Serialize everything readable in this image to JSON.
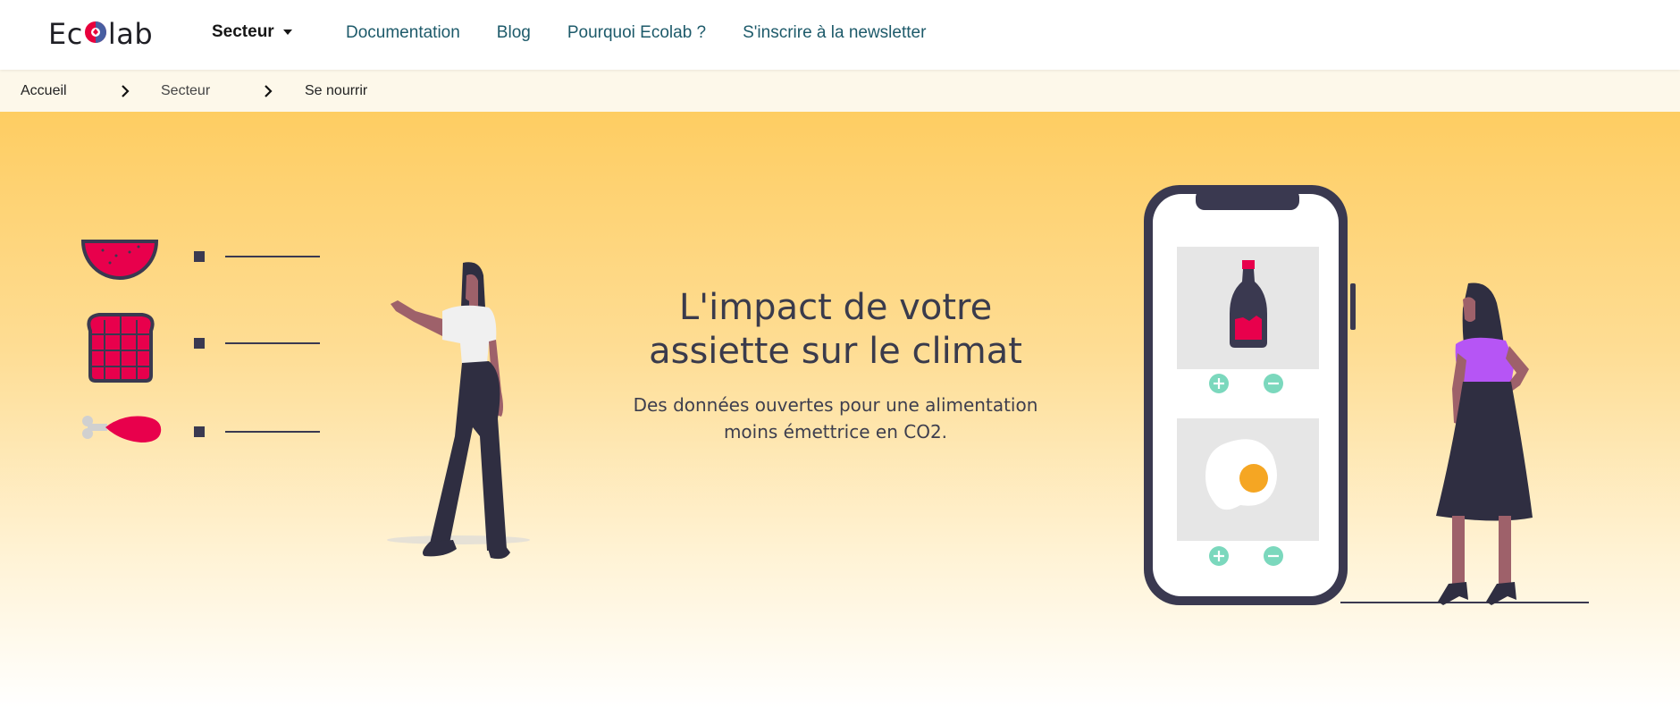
{
  "header": {
    "logo_text_left": "Ec",
    "logo_text_right": "lab",
    "secteur_label": "Secteur",
    "nav": [
      "Documentation",
      "Blog",
      "Pourquoi Ecolab ?",
      "S'inscrire à la newsletter"
    ]
  },
  "breadcrumb": {
    "items": [
      "Accueil",
      "Secteur",
      "Se nourrir"
    ]
  },
  "hero": {
    "title": "L'impact de votre assiette sur le climat",
    "subtitle": "Des données ouvertes pour une alimentation moins émettrice en CO2."
  },
  "colors": {
    "accent": "#e8004c",
    "nav_link": "#1d5a6a",
    "dark": "#3a3950",
    "hero_top": "#fecd62",
    "mint": "#7bd8bd",
    "purple": "#b655f5"
  },
  "icons": [
    "globe-icon",
    "caret-down-icon",
    "chevron-right-icon",
    "watermelon-icon",
    "toast-icon",
    "drumstick-icon",
    "ketchup-icon",
    "egg-icon",
    "plus-icon",
    "minus-icon"
  ]
}
